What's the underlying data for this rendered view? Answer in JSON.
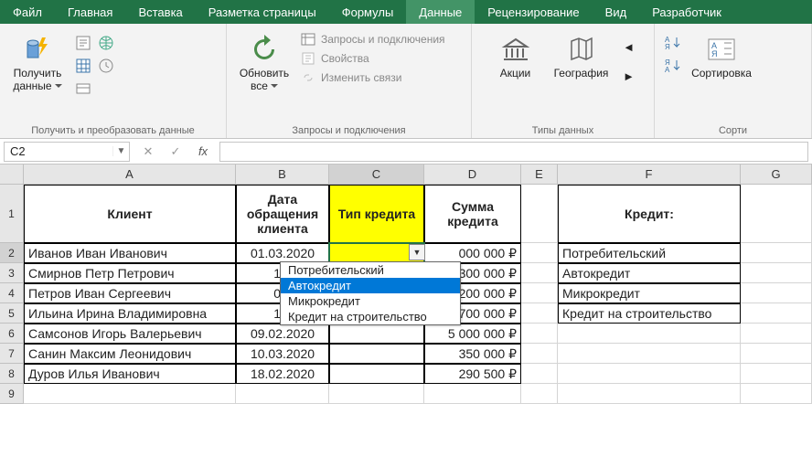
{
  "menu": [
    "Файл",
    "Главная",
    "Вставка",
    "Разметка страницы",
    "Формулы",
    "Данные",
    "Рецензирование",
    "Вид",
    "Разработчик"
  ],
  "menu_active": 5,
  "ribbon": {
    "g1": {
      "label": "Получить и преобразовать данные",
      "get_data": "Получить\nданные"
    },
    "g2": {
      "label": "Запросы и подключения",
      "refresh": "Обновить\nвсе",
      "r1": "Запросы и подключения",
      "r2": "Свойства",
      "r3": "Изменить связи"
    },
    "g3": {
      "label": "Типы данных",
      "stocks": "Акции",
      "geo": "География"
    },
    "g4": {
      "label": "Сорти",
      "sort": "Сортировка"
    }
  },
  "namebox": "C2",
  "formula": "",
  "cols": [
    "A",
    "B",
    "C",
    "D",
    "E",
    "F",
    "G"
  ],
  "active_col": "C",
  "active_row": 2,
  "headers": {
    "A": "Клиент",
    "B": "Дата обращения клиента",
    "C": "Тип кредита",
    "D": "Сумма кредита",
    "F": "Кредит:"
  },
  "rowsData": [
    {
      "r": 2,
      "A": "Иванов Иван Иванович",
      "B": "01.03.2020",
      "C": "",
      "D": "000 000 ₽",
      "F": "Потребительский"
    },
    {
      "r": 3,
      "A": "Смирнов Петр Петрович",
      "B": "15.",
      "D": "300 000 ₽",
      "F": "Автокредит"
    },
    {
      "r": 4,
      "A": "Петров Иван Сергеевич",
      "B": "03.",
      "D": "200 000 ₽",
      "F": "Микрокредит"
    },
    {
      "r": 5,
      "A": "Ильина Ирина Владимировна",
      "B": "17.",
      "D": "700 000 ₽",
      "F": "Кредит на строительство"
    },
    {
      "r": 6,
      "A": "Самсонов Игорь Валерьевич",
      "B": "09.02.2020",
      "D": "5 000 000 ₽"
    },
    {
      "r": 7,
      "A": "Санин Максим Леонидович",
      "B": "10.03.2020",
      "D": "350 000 ₽"
    },
    {
      "r": 8,
      "A": "Дуров Илья Иванович",
      "B": "18.02.2020",
      "D": "290 500 ₽"
    }
  ],
  "dropdown": {
    "options": [
      "Потребительский",
      "Автокредит",
      "Микрокредит",
      "Кредит на строительство"
    ],
    "highlighted": 1
  }
}
